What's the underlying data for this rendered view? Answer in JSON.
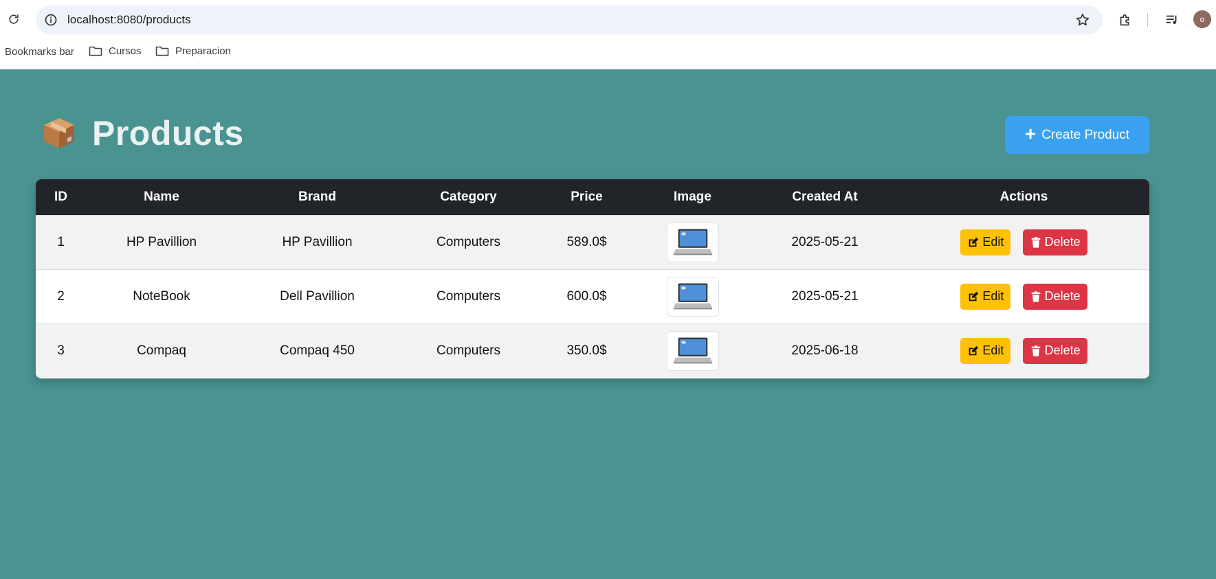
{
  "browser": {
    "url": "localhost:8080/products",
    "avatar_letter": "o",
    "bookmarks_bar_label": "Bookmarks bar",
    "bookmark_folders": [
      "Cursos",
      "Preparacion"
    ]
  },
  "header": {
    "title": "Products",
    "emoji": "📦",
    "create_button_label": "Create Product"
  },
  "table": {
    "columns": [
      "ID",
      "Name",
      "Brand",
      "Category",
      "Price",
      "Image",
      "Created At",
      "Actions"
    ],
    "rows": [
      {
        "id": "1",
        "name": "HP Pavillion",
        "brand": "HP Pavillion",
        "category": "Computers",
        "price": "589.0$",
        "created_at": "2025-05-21"
      },
      {
        "id": "2",
        "name": "NoteBook",
        "brand": "Dell Pavillion",
        "category": "Computers",
        "price": "600.0$",
        "created_at": "2025-05-21"
      },
      {
        "id": "3",
        "name": "Compaq",
        "brand": "Compaq 450",
        "category": "Computers",
        "price": "350.0$",
        "created_at": "2025-06-18"
      }
    ],
    "edit_label": "Edit",
    "delete_label": "Delete"
  },
  "colors": {
    "page_bg": "#4a9391",
    "header_bg": "#212529",
    "create_button": "#3aa1f0",
    "edit_button": "#ffc107",
    "delete_button": "#dc3545"
  }
}
